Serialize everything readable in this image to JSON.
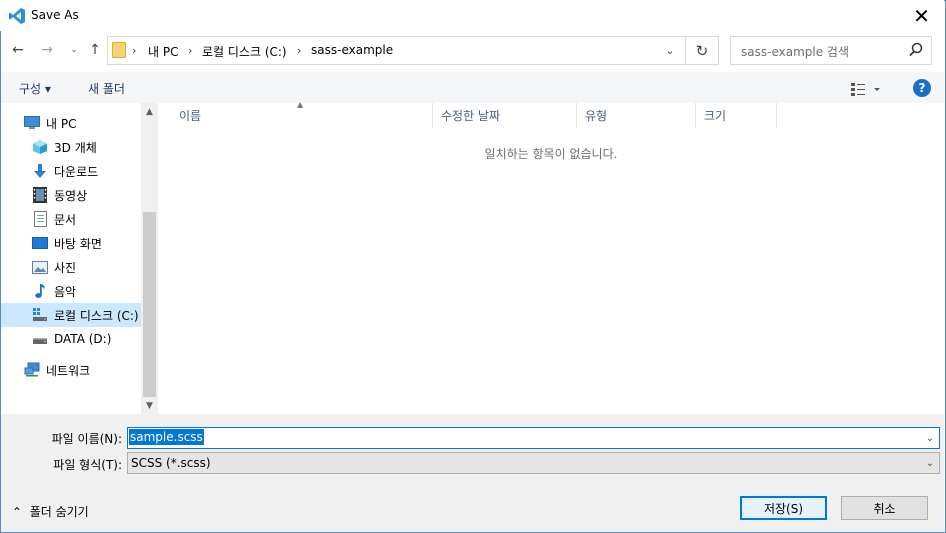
{
  "window": {
    "title": "Save As",
    "close_glyph": "✕"
  },
  "nav": {
    "back_glyph": "←",
    "forward_glyph": "→",
    "recent_glyph": "⌄",
    "up_glyph": "↑",
    "breadcrumb": [
      "내 PC",
      "로컬 디스크 (C:)",
      "sass-example"
    ],
    "breadcrumb_sep": "›",
    "refresh_glyph": "↻",
    "search_placeholder": "sass-example 검색"
  },
  "toolbar": {
    "organize_label": "구성 ▾",
    "new_folder_label": "새 폴더",
    "help_label": "?"
  },
  "tree": {
    "items": [
      {
        "label": "내 PC",
        "icon": "pc-icon"
      },
      {
        "label": "3D 개체",
        "icon": "3d-objects-icon"
      },
      {
        "label": "다운로드",
        "icon": "download-icon"
      },
      {
        "label": "동영상",
        "icon": "video-icon"
      },
      {
        "label": "문서",
        "icon": "document-icon"
      },
      {
        "label": "바탕 화면",
        "icon": "desktop-icon"
      },
      {
        "label": "사진",
        "icon": "pictures-icon"
      },
      {
        "label": "음악",
        "icon": "music-icon"
      },
      {
        "label": "로컬 디스크 (C:)",
        "icon": "drive-c-icon",
        "selected": true
      },
      {
        "label": "DATA (D:)",
        "icon": "drive-d-icon"
      },
      {
        "label": "네트워크",
        "icon": "network-icon"
      }
    ]
  },
  "filelist": {
    "columns": [
      "이름",
      "수정한 날짜",
      "유형",
      "크기"
    ],
    "empty_message": "일치하는 항목이 없습니다."
  },
  "form": {
    "filename_label": "파일 이름(N):",
    "filename_value": "sample.scss",
    "filetype_label": "파일 형식(T):",
    "filetype_value": "SCSS (*.scss)",
    "dropdown_glyph": "⌄"
  },
  "footer": {
    "hide_folders_label": "폴더 숨기기",
    "hide_glyph": "⌃",
    "save_label": "저장(S)",
    "cancel_label": "취소"
  },
  "colors": {
    "accent": "#0078d7",
    "selection_bg": "#cce8ff",
    "app_icon_blue": "#2b8fe0"
  }
}
